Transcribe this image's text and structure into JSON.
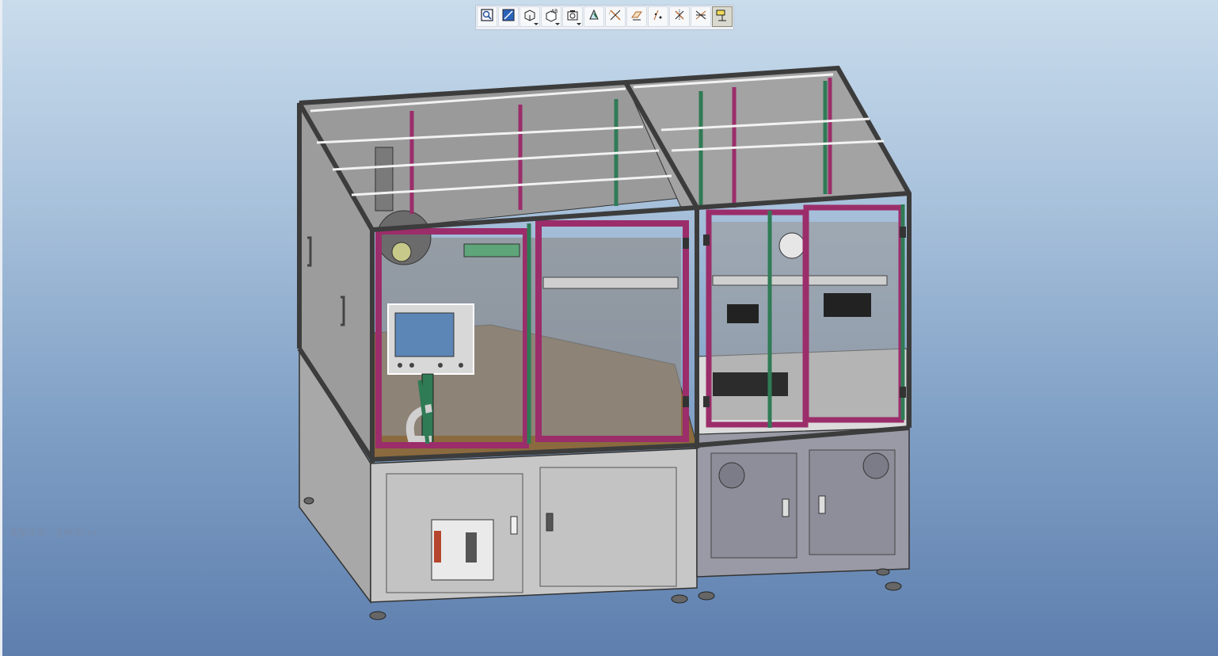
{
  "toolbar": {
    "buttons": [
      {
        "icon": "zoom-to-fit-icon",
        "label": "Refit"
      },
      {
        "icon": "zoom-window-icon",
        "label": "Zoom In"
      },
      {
        "icon": "display-style-icon",
        "label": "Display Style"
      },
      {
        "icon": "saved-orientations-icon",
        "label": "Saved Orientations"
      },
      {
        "icon": "view-manager-icon",
        "label": "View Manager"
      },
      {
        "icon": "perspective-view-icon",
        "label": "Perspective View"
      },
      {
        "icon": "datum-axes-display-icon",
        "label": "Axis Display"
      },
      {
        "icon": "datum-planes-display-icon",
        "label": "Plane Display"
      },
      {
        "icon": "datum-points-display-icon",
        "label": "Point Display"
      },
      {
        "icon": "coordinate-systems-display-icon",
        "label": "Csys Display"
      },
      {
        "icon": "spin-center-display-icon",
        "label": "Spin Center"
      },
      {
        "icon": "annotation-display-icon",
        "label": "Annotation Display"
      }
    ],
    "active_index": 11
  },
  "status_text": "造型状态：主样式(+)",
  "colors": {
    "frame_dark": "#3c3c3c",
    "frame_magenta": "#9b2d6a",
    "frame_green": "#2f7b55",
    "panel_grey": "#b9b9b9",
    "base_grey": "#c8c8c8",
    "deck_brown": "#8a6a3e",
    "screen_blue": "#5c86b6"
  }
}
